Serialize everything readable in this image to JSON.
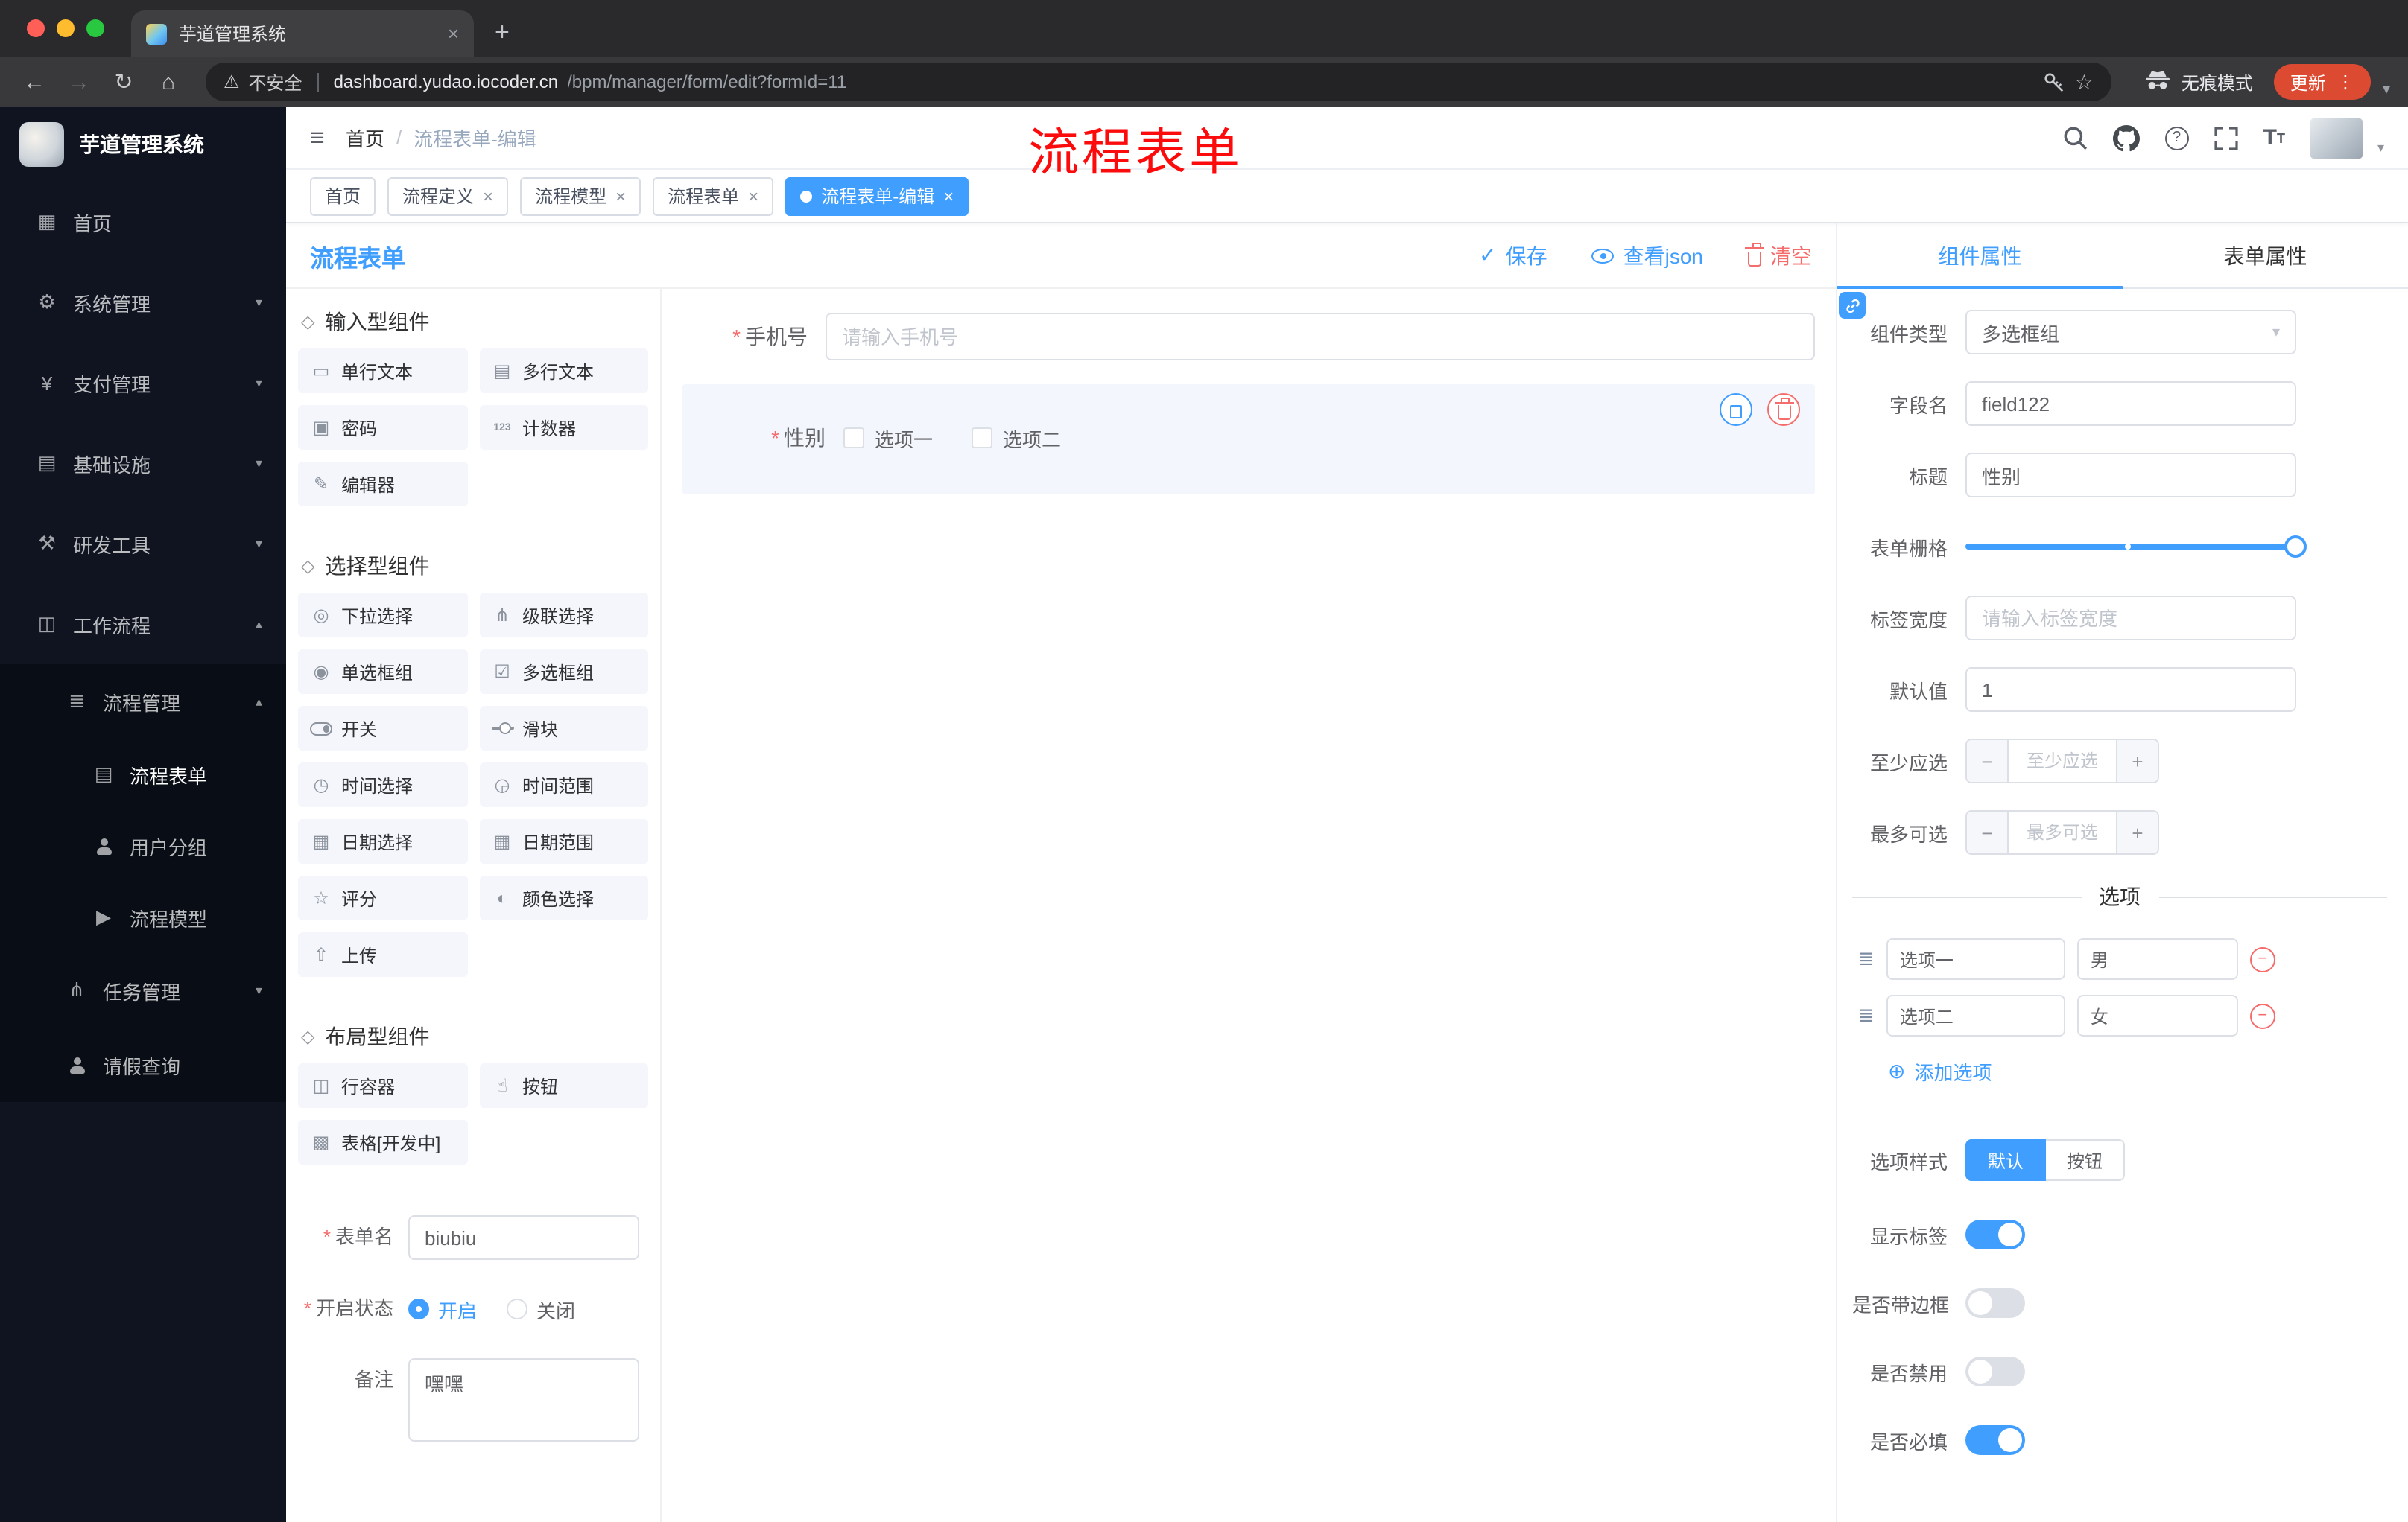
{
  "colors": {
    "accent": "#409eff",
    "danger": "#f56c6c",
    "annotation": "#fb0b0b",
    "sidebar_bg": "#0f1420"
  },
  "icons": {
    "close": "×",
    "plus": "+",
    "minus": "−",
    "back": "←",
    "forward": "→",
    "reload": "↻",
    "home_nav": "⌂",
    "warning": "⚠",
    "star": "☆",
    "kebab": "⋮",
    "caret_down": "▾",
    "hamburger": "≡",
    "question": "?",
    "check": "✓",
    "chevron_down": "▾",
    "chevron_up": "▴",
    "select_arrow": "▾",
    "add_circle": "⊕",
    "drag": "≣",
    "required": "*",
    "font_size": "T",
    "slash": "/"
  },
  "browser": {
    "tab_title": "芋道管理系统",
    "security_label": "不安全",
    "url_host": "dashboard.yudao.iocoder.cn",
    "url_path": "/bpm/manager/form/edit?formId=11",
    "incognito_label": "无痕模式",
    "update_label": "更新"
  },
  "sidebar": {
    "app_title": "芋道管理系统",
    "items": [
      {
        "label": "首页",
        "icon": "▦"
      },
      {
        "label": "系统管理",
        "icon": "⚙"
      },
      {
        "label": "支付管理",
        "icon": "¥"
      },
      {
        "label": "基础设施",
        "icon": "▤"
      },
      {
        "label": "研发工具",
        "icon": "⚒"
      },
      {
        "label": "工作流程",
        "icon": "◫"
      },
      {
        "label": "流程管理",
        "icon": "≣"
      },
      {
        "label": "流程表单",
        "icon": "▤",
        "active": true
      },
      {
        "label": "用户分组",
        "icon": "user"
      },
      {
        "label": "流程模型",
        "icon": "▶"
      },
      {
        "label": "任务管理",
        "icon": "⋔"
      },
      {
        "label": "请假查询",
        "icon": "user"
      }
    ]
  },
  "header": {
    "breadcrumb_home": "首页",
    "breadcrumb_sep": "/",
    "breadcrumb_current": "流程表单-编辑",
    "annotation": "流程表单"
  },
  "tags": [
    {
      "label": "首页"
    },
    {
      "label": "流程定义"
    },
    {
      "label": "流程模型"
    },
    {
      "label": "流程表单"
    },
    {
      "label": "流程表单-编辑",
      "active": true
    }
  ],
  "designer": {
    "title": "流程表单",
    "save_label": "保存",
    "view_json_label": "查看json",
    "clear_label": "清空",
    "palette": {
      "groups": [
        {
          "title": "输入型组件",
          "items": [
            {
              "label": "单行文本",
              "icon": "▭"
            },
            {
              "label": "多行文本",
              "icon": "▤"
            },
            {
              "label": "密码",
              "icon": "▣"
            },
            {
              "label": "计数器",
              "icon": "123"
            },
            {
              "label": "编辑器",
              "icon": "✎"
            }
          ]
        },
        {
          "title": "选择型组件",
          "items": [
            {
              "label": "下拉选择",
              "icon": "◎"
            },
            {
              "label": "级联选择",
              "icon": "⋔"
            },
            {
              "label": "单选框组",
              "icon": "◉"
            },
            {
              "label": "多选框组",
              "icon": "☑"
            },
            {
              "label": "开关",
              "icon": "switch"
            },
            {
              "label": "滑块",
              "icon": "slider"
            },
            {
              "label": "时间选择",
              "icon": "◷"
            },
            {
              "label": "时间范围",
              "icon": "◶"
            },
            {
              "label": "日期选择",
              "icon": "▦"
            },
            {
              "label": "日期范围",
              "icon": "▦"
            },
            {
              "label": "评分",
              "icon": "☆"
            },
            {
              "label": "颜色选择",
              "icon": "◐"
            },
            {
              "label": "上传",
              "icon": "⇧"
            }
          ]
        },
        {
          "title": "布局型组件",
          "items": [
            {
              "label": "行容器",
              "icon": "◫"
            },
            {
              "label": "按钮",
              "icon": "☝"
            },
            {
              "label": "表格[开发中]",
              "icon": "▩"
            }
          ]
        }
      ]
    },
    "meta": {
      "form_name_label": "表单名",
      "form_name_value": "biubiu",
      "status_label": "开启状态",
      "status_on": "开启",
      "status_off": "关闭",
      "remark_label": "备注",
      "remark_value": "嘿嘿"
    },
    "canvas": {
      "phone_label": "手机号",
      "phone_placeholder": "请输入手机号",
      "gender_label": "性别",
      "gender_option1": "选项一",
      "gender_option2": "选项二"
    }
  },
  "panel": {
    "tab_component": "组件属性",
    "tab_form": "表单属性",
    "component_type_label": "组件类型",
    "component_type_value": "多选框组",
    "field_name_label": "字段名",
    "field_name_value": "field122",
    "title_label": "标题",
    "title_value": "性别",
    "grid_label": "表单栅格",
    "label_width_label": "标签宽度",
    "label_width_placeholder": "请输入标签宽度",
    "default_label": "默认值",
    "default_value": "1",
    "min_label": "至少应选",
    "min_placeholder": "至少应选",
    "max_label": "最多可选",
    "max_placeholder": "最多可选",
    "options_title": "选项",
    "options": [
      {
        "label": "选项一",
        "value": "男"
      },
      {
        "label": "选项二",
        "value": "女"
      }
    ],
    "add_option_label": "添加选项",
    "option_style_label": "选项样式",
    "style_default": "默认",
    "style_button": "按钮",
    "show_label_label": "显示标签",
    "border_label": "是否带边框",
    "disabled_label": "是否禁用",
    "required_label": "是否必填"
  }
}
